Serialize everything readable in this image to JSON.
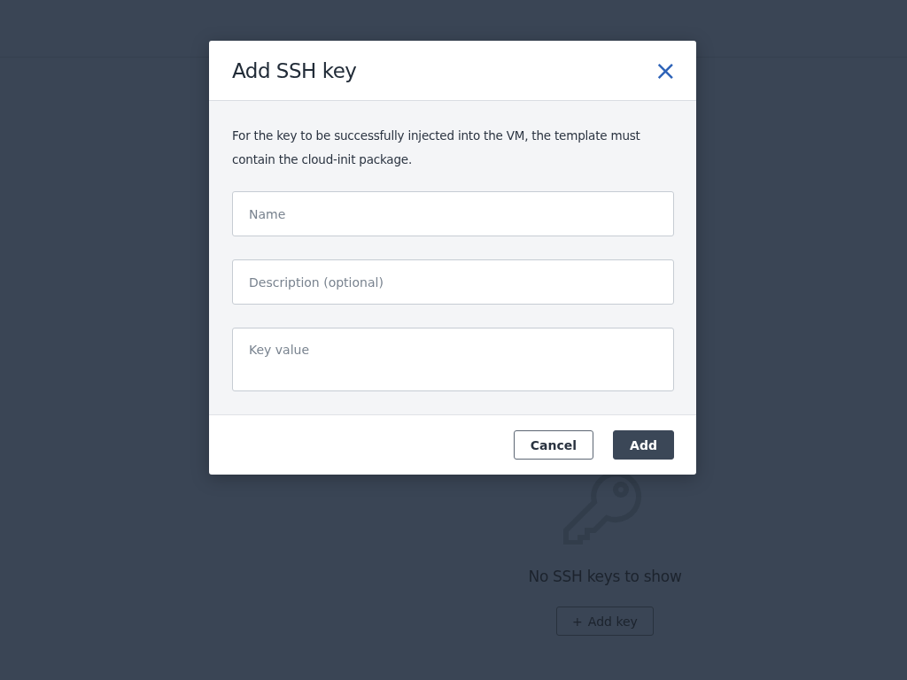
{
  "background": {
    "empty_state": {
      "message": "No SSH keys to show",
      "button": {
        "icon": "+",
        "label": "Add key"
      }
    }
  },
  "dialog": {
    "title": "Add SSH key",
    "close": "×",
    "note": "For the key to be successfully injected into the VM, the template must contain the cloud-init package.",
    "fields": [
      {
        "kind": "input",
        "placeholder": "Name"
      },
      {
        "kind": "input",
        "placeholder": "Description (optional)"
      },
      {
        "kind": "textarea",
        "placeholder": "Key value"
      }
    ],
    "buttons": [
      {
        "label": "Cancel",
        "kind": "secondary"
      },
      {
        "label": "Add",
        "kind": "primary"
      }
    ]
  }
}
